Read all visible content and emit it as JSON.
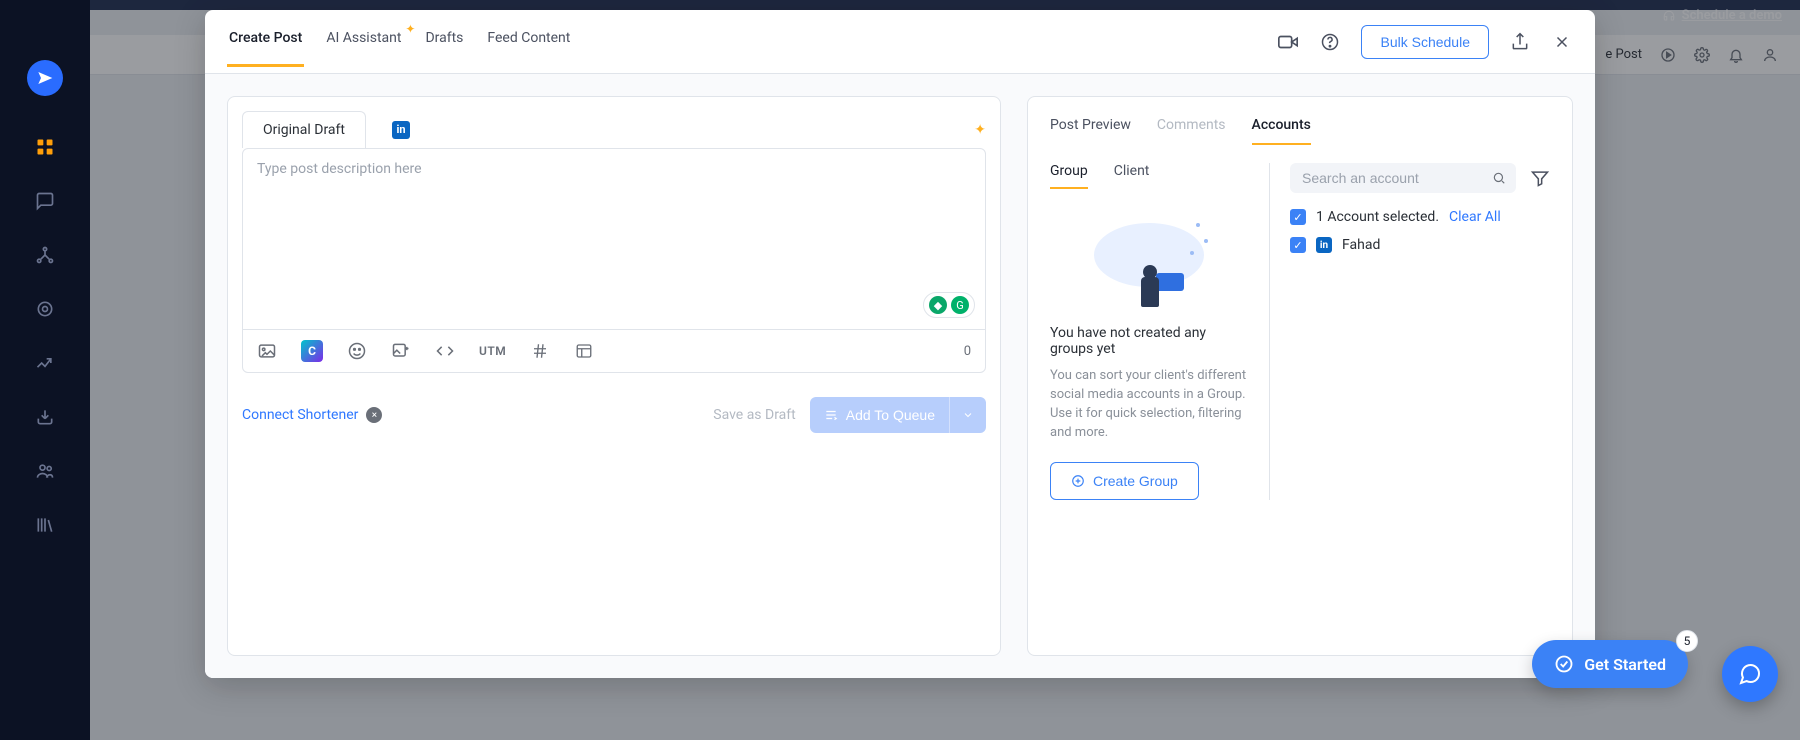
{
  "demo_link": "Schedule a demo",
  "page_header": {
    "create_post": "e Post"
  },
  "modal": {
    "tabs": {
      "create_post": "Create Post",
      "ai_assistant": "AI Assistant",
      "drafts": "Drafts",
      "feed_content": "Feed Content"
    },
    "bulk_schedule": "Bulk Schedule"
  },
  "composer": {
    "draft_tab": "Original Draft",
    "placeholder": "Type post description here",
    "utm": "UTM",
    "char_count": "0",
    "connect_shortener": "Connect Shortener",
    "save_as_draft": "Save as Draft",
    "add_to_queue": "Add To Queue"
  },
  "right": {
    "tabs": {
      "post_preview": "Post Preview",
      "comments": "Comments",
      "accounts": "Accounts"
    },
    "gc_tabs": {
      "group": "Group",
      "client": "Client"
    },
    "empty_title": "You have not created any groups yet",
    "empty_desc": "You can sort your client's different social media accounts in a Group. Use it for quick selection, filtering and more.",
    "create_group": "Create Group",
    "search_placeholder": "Search an account",
    "selected_line": "1 Account selected.",
    "clear_all": "Clear All",
    "account_name": "Fahad"
  },
  "get_started": {
    "label": "Get Started",
    "badge": "5"
  }
}
